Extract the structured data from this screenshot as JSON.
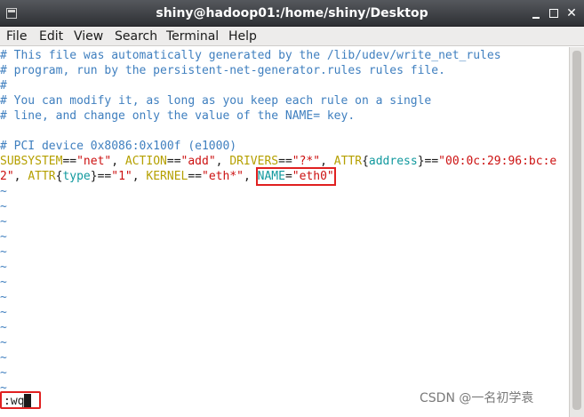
{
  "window": {
    "title": "shiny@hadoop01:/home/shiny/Desktop",
    "close_glyph": "✕"
  },
  "menu": {
    "items": [
      "File",
      "Edit",
      "View",
      "Search",
      "Terminal",
      "Help"
    ]
  },
  "editor": {
    "comments": [
      "# This file was automatically generated by the /lib/udev/write_net_rules",
      "# program, run by the persistent-net-generator.rules rules file.",
      "#",
      "# You can modify it, as long as you keep each rule on a single",
      "# line, and change only the value of the NAME= key.",
      "",
      "# PCI device 0x8086:0x100f (e1000)"
    ],
    "rule": {
      "subsystem_key": "SUBSYSTEM",
      "eqeq": "==",
      "subsystem_val": "\"net\"",
      "sep": ", ",
      "action_key": "ACTION",
      "action_val": "\"add\"",
      "drivers_key": "DRIVERS",
      "drivers_val": "\"?*\"",
      "attr_key": "ATTR",
      "brace_open": "{",
      "brace_close": "}",
      "address_attr": "address",
      "address_val_part1": "\"00:0c:29:96:bc:e",
      "address_val_part2": "2\"",
      "type_attr": "type",
      "type_val": "\"1\"",
      "kernel_key": "KERNEL",
      "kernel_val": "\"eth*\"",
      "name_key": "NAME",
      "eq": "=",
      "name_val": "\"eth0\""
    },
    "tilde": "~",
    "tilde_count": 14,
    "command": ":wq"
  },
  "watermark": "CSDN @一名初学袁",
  "colors": {
    "comment": "#3f7fbf",
    "key": "#b5a000",
    "string": "#cc1111",
    "attr": "#11999e",
    "highlight_box": "#e02020"
  }
}
